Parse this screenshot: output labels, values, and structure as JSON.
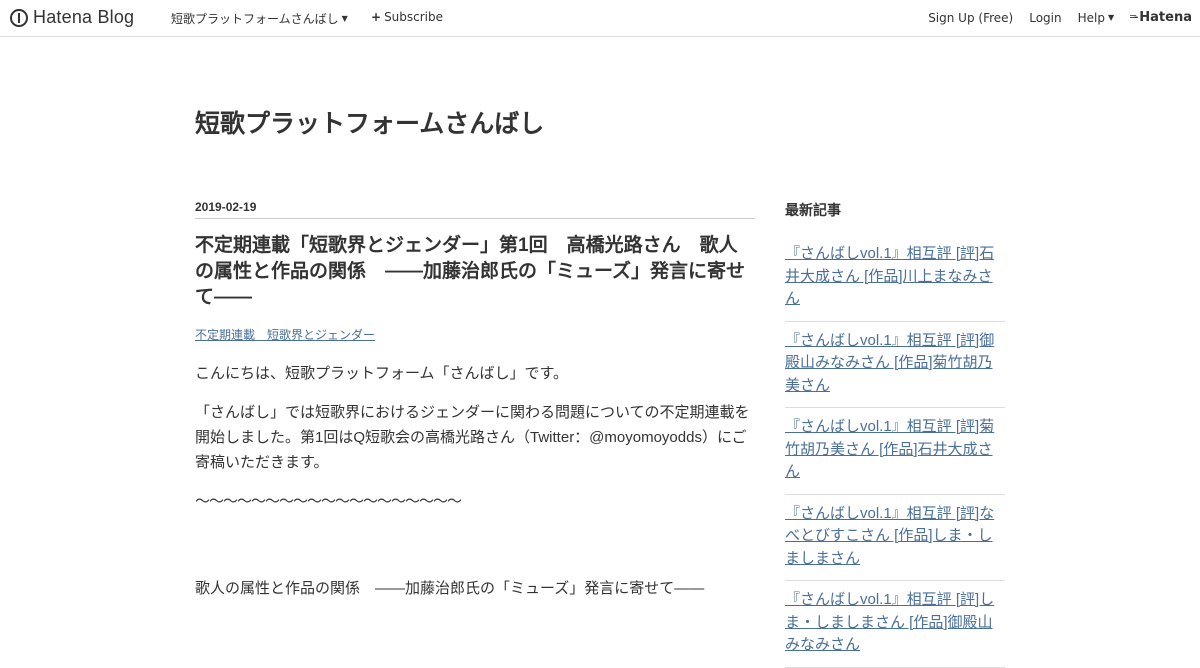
{
  "header": {
    "logo_text": "Hatena Blog",
    "blog_name": "短歌プラットフォームさんばし",
    "subscribe_label": "Subscribe",
    "signup_label": "Sign Up (Free)",
    "login_label": "Login",
    "help_label": "Help",
    "brand_label": "Hatena"
  },
  "blog": {
    "title": "短歌プラットフォームさんばし"
  },
  "entry": {
    "date": "2019-02-19",
    "title": "不定期連載「短歌界とジェンダー」第1回　高橋光路さん　歌人の属性と作品の関係　――加藤治郎氏の「ミューズ」発言に寄せて――",
    "category": "不定期連載　短歌界とジェンダー",
    "paragraphs": [
      "こんにちは、短歌プラットフォーム「さんばし」です。",
      "「さんばし」では短歌界におけるジェンダーに関わる問題についての不定期連載を開始しました。第1回はQ短歌会の高橋光路さん（Twitter：@moyomoyodds）にご寄稿いただきます。",
      "〜〜〜〜〜〜〜〜〜〜〜〜〜〜〜〜〜〜〜",
      "歌人の属性と作品の関係　――加藤治郎氏の「ミューズ」発言に寄せて――"
    ]
  },
  "sidebar": {
    "title": "最新記事",
    "items": [
      "『さんばしvol.1』相互評 [評]石井大成さん [作品]川上まなみさん",
      "『さんばしvol.1』相互評 [評]御殿山みなみさん [作品]菊竹胡乃美さん",
      "『さんばしvol.1』相互評 [評]菊竹胡乃美さん [作品]石井大成さん",
      "『さんばしvol.1』相互評 [評]なべとびすこさん [作品]しま・しましまさん",
      "『さんばしvol.1』相互評 [評]しま・しましまさん [作品]御殿山みなみさん"
    ]
  },
  "icons": {
    "logo": "hatena-blog-logo-icon",
    "subscribe": "plus-icon",
    "dropdown": "caret-down-icon",
    "brand": "hatena-brand-icon"
  }
}
